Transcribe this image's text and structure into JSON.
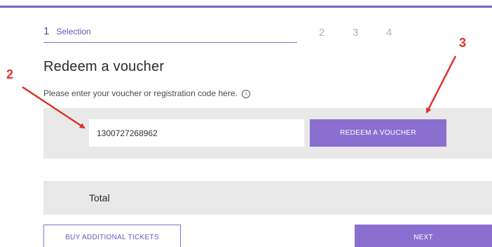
{
  "stepper": {
    "active": {
      "number": "1",
      "label": "Selection"
    },
    "upcoming": [
      "2",
      "3",
      "4"
    ]
  },
  "heading": "Redeem a voucher",
  "instruction": "Please enter your voucher or registration code here.",
  "info_icon_glyph": "i",
  "voucher": {
    "input_value": "1300727268962",
    "redeem_label": "REDEEM A VOUCHER"
  },
  "total_label": "Total",
  "buttons": {
    "buy_additional": "BUY ADDITIONAL TICKETS",
    "next": "NEXT"
  },
  "annotations": {
    "callout_2": "2",
    "callout_3": "3",
    "color": "#e0322a"
  },
  "colors": {
    "accent": "#8a6fd0",
    "panel": "#e9e9ea"
  }
}
